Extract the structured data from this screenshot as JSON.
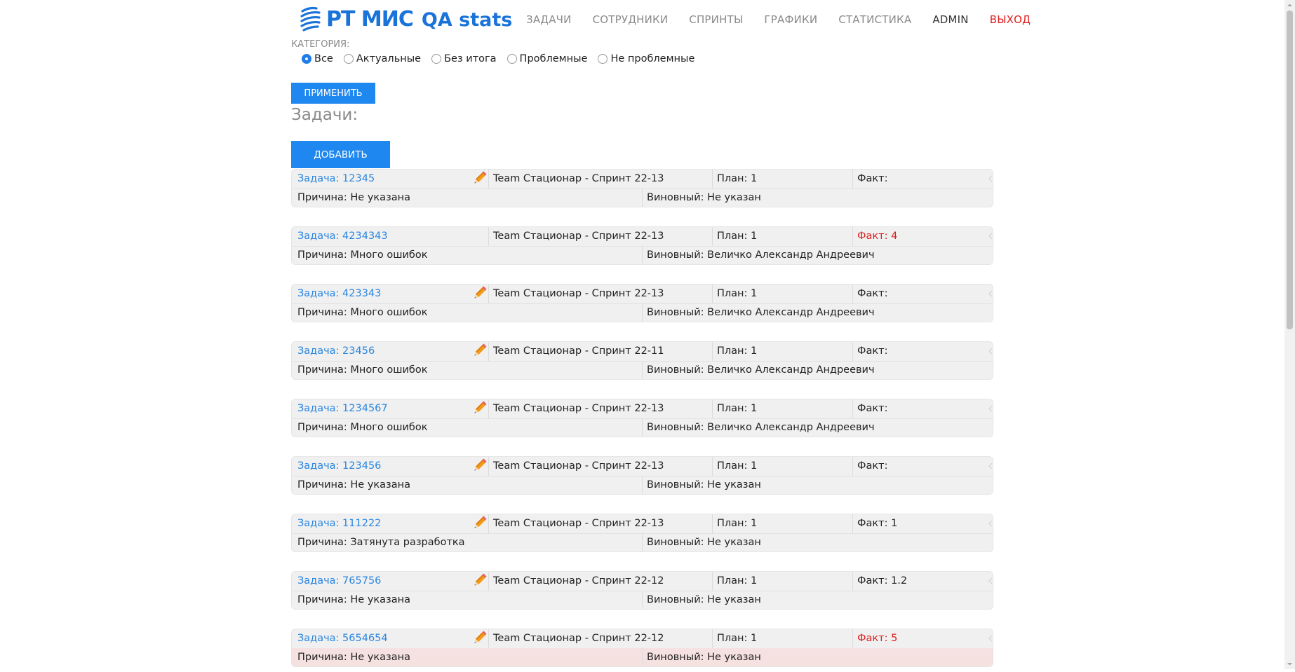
{
  "header": {
    "logo_text": "РТ МИС",
    "logo_suffix": "QA stats",
    "nav": [
      {
        "label": "ЗАДАЧИ"
      },
      {
        "label": "СОТРУДНИКИ"
      },
      {
        "label": "СПРИНТЫ"
      },
      {
        "label": "ГРАФИКИ"
      },
      {
        "label": "СТАТИСТИКА"
      },
      {
        "label": "ADMIN"
      },
      {
        "label": "ВЫХОД"
      }
    ]
  },
  "filter": {
    "label": "КАТЕГОРИЯ:",
    "options": [
      "Все",
      "Актуальные",
      "Без итога",
      "Проблемные",
      "Не проблемные"
    ],
    "selected": "Все",
    "apply_label": "ПРИМЕНИТЬ"
  },
  "tasks_title": "Задачи:",
  "add_label": "ДОБАВИТЬ",
  "colors": {
    "accent": "#1f87f0",
    "link": "#2a86e0",
    "danger": "#e01c1c",
    "row_bg": "#f0f0f0",
    "highlight_bg": "#f6e1e1"
  },
  "tasks": [
    {
      "id": "Задача: 12345",
      "editable": true,
      "team": "Team Стационар - Спринт 22-13",
      "plan": "План: 1",
      "fact": "Факт:",
      "fact_alert": false,
      "reason": "Причина: Не указана",
      "guilty": "Виновный: Не указан",
      "highlight": false
    },
    {
      "id": "Задача: 4234343",
      "editable": false,
      "team": "Team Стационар - Спринт 22-13",
      "plan": "План: 1",
      "fact": "Факт: 4",
      "fact_alert": true,
      "reason": "Причина: Много ошибок",
      "guilty": "Виновный: Величко Александр Андреевич",
      "highlight": false
    },
    {
      "id": "Задача: 423343",
      "editable": true,
      "team": "Team Стационар - Спринт 22-13",
      "plan": "План: 1",
      "fact": "Факт:",
      "fact_alert": false,
      "reason": "Причина: Много ошибок",
      "guilty": "Виновный: Величко Александр Андреевич",
      "highlight": false
    },
    {
      "id": "Задача: 23456",
      "editable": true,
      "team": "Team Стационар - Спринт 22-11",
      "plan": "План: 1",
      "fact": "Факт:",
      "fact_alert": false,
      "reason": "Причина: Много ошибок",
      "guilty": "Виновный: Величко Александр Андреевич",
      "highlight": false
    },
    {
      "id": "Задача: 1234567",
      "editable": true,
      "team": "Team Стационар - Спринт 22-13",
      "plan": "План: 1",
      "fact": "Факт:",
      "fact_alert": false,
      "reason": "Причина: Много ошибок",
      "guilty": "Виновный: Величко Александр Андреевич",
      "highlight": false
    },
    {
      "id": "Задача: 123456",
      "editable": true,
      "team": "Team Стационар - Спринт 22-13",
      "plan": "План: 1",
      "fact": "Факт:",
      "fact_alert": false,
      "reason": "Причина: Не указана",
      "guilty": "Виновный: Не указан",
      "highlight": false
    },
    {
      "id": "Задача: 111222",
      "editable": true,
      "team": "Team Стационар - Спринт 22-13",
      "plan": "План: 1",
      "fact": "Факт: 1",
      "fact_alert": false,
      "reason": "Причина: Затянута разработка",
      "guilty": "Виновный: Не указан",
      "highlight": false
    },
    {
      "id": "Задача: 765756",
      "editable": true,
      "team": "Team Стационар - Спринт 22-12",
      "plan": "План: 1",
      "fact": "Факт: 1.2",
      "fact_alert": false,
      "reason": "Причина: Не указана",
      "guilty": "Виновный: Не указан",
      "highlight": false
    },
    {
      "id": "Задача: 5654654",
      "editable": true,
      "team": "Team Стационар - Спринт 22-12",
      "plan": "План: 1",
      "fact": "Факт: 5",
      "fact_alert": true,
      "reason": "Причина: Не указана",
      "guilty": "Виновный: Не указан",
      "highlight": true
    }
  ]
}
